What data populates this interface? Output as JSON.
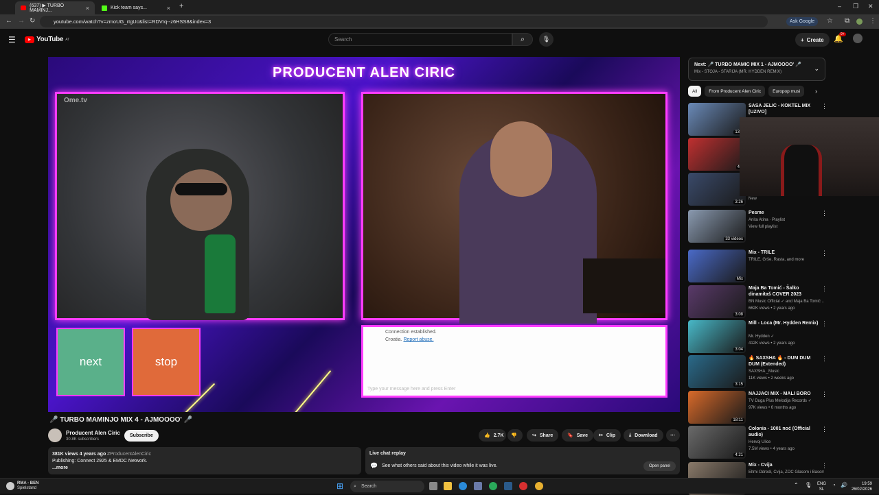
{
  "browser": {
    "tabs": [
      {
        "label": "(637) ▶ TURBO MAMINJ...",
        "active": true
      },
      {
        "label": "Kick team says...",
        "active": false
      }
    ],
    "new_tab": "+",
    "url": "youtube.com/watch?v=zmoUG_rIgUc&list=RDVrq--z6HSS8&index=3",
    "ask_google": "Ask Google"
  },
  "youtube": {
    "logo": "YouTube",
    "logo_region": "AT",
    "search_placeholder": "Search",
    "create_label": "Create",
    "notif_count": "9+"
  },
  "video": {
    "overlay_title": "PRODUCENT ALEN CIRIC",
    "ome_logo": "Ome.tv",
    "btn_next": "next",
    "btn_stop": "stop",
    "chat_line1": "Connection established.",
    "chat_line2": "Croatia.",
    "chat_report": "Report abuse.",
    "chat_placeholder": "Type your message here and press Enter",
    "title": "🎤 TURBO MAMINJO MIX 4 - AJMOOOO' 🎤"
  },
  "channel": {
    "name": "Producent Alen Ciric",
    "subs": "30.8K subscribers",
    "subscribe": "Subscribe"
  },
  "actions": {
    "likes": "2.7K",
    "share": "Share",
    "save": "Save",
    "clip": "Clip",
    "download": "Download"
  },
  "description": {
    "stats": "381K views  4 years ago",
    "hashtag": "#ProducentAlenCiric",
    "line2": "Publishing: Connect 2925 & EMDC Network.",
    "more": "...more"
  },
  "live_chat": {
    "title": "Live chat replay",
    "text": "See what others said about this video while it was live.",
    "open": "Open panel"
  },
  "sidebar": {
    "next_label": "Next: 🎤 TURBO MAMIC MIX 1 - AJMOOOO' 🎤",
    "next_sub": "Mix - STOJA - STARIJA (MR. HYDDEN REMIX)",
    "chips": [
      "All",
      "From Producent Alen Ciric",
      "Europop musi"
    ],
    "items": [
      {
        "title": "SASA JELIC - KOKTEL MIX [UZIVO]",
        "meta1": "",
        "meta2": "",
        "dur": "13:5",
        "color": "#6a8ab8"
      },
      {
        "title": "",
        "meta1": "",
        "meta2": "",
        "dur": "4:4",
        "color": "#c03030"
      },
      {
        "title": "",
        "meta1": "",
        "meta2": "New",
        "dur": "3:26",
        "color": "#3a4a6a"
      },
      {
        "title": "Pesme",
        "meta1": "Anita Atina · Playlist",
        "meta2": "View full playlist",
        "dur": "33 videos",
        "color": "#8a9ab0"
      },
      {
        "title": "Mix - TRILE",
        "meta1": "TRILE, Grše, Rasta, and more",
        "meta2": "",
        "dur": "Mix",
        "color": "#4a6ac8"
      },
      {
        "title": "Maja Ba Tomić - Šalko dinamitaš COVER 2023",
        "meta1": "BN Music Official ✓ and Maja Ba Tomić ...",
        "meta2": "662K views • 2 years ago",
        "dur": "3:08",
        "color": "#5a3a6a"
      },
      {
        "title": "Mill - Loca (Mr. Hydden Remix)",
        "meta1": "Mr. Hydden ✓",
        "meta2": "412K views • 2 years ago",
        "dur": "3:04",
        "color": "#48b8c8"
      },
      {
        "title": "🔥 SAXSHA 🔥 - DUM DUM DUM (Extended)",
        "meta1": "SAXSHA _Music",
        "meta2": "11K views • 2 weeks ago",
        "dur": "3:15",
        "color": "#2a6a8a"
      },
      {
        "title": "NAJJACI MIX - MALI BORO",
        "meta1": "TV Duga Plus Melodija Records ✓",
        "meta2": "97K views • 6 months ago",
        "dur": "18:11",
        "color": "#d86a2a"
      },
      {
        "title": "Colonia - 1001 noć (Official audio)",
        "meta1": "Hervoj Ulice",
        "meta2": "7.5M views • 4 years ago",
        "dur": "4:21",
        "color": "#6a6a6a"
      },
      {
        "title": "Mix - Cvija",
        "meta1": "Eltmi Odredi, Cvija, ZOC Glasom i Basom...",
        "meta2": "",
        "dur": "",
        "color": "#8a7a6a"
      }
    ]
  },
  "taskbar": {
    "weather1": "RMA - BEN",
    "weather2": "Spielstand",
    "search": "Search",
    "lang1": "ENG",
    "lang2": "SL",
    "time": "19:59",
    "date": "26/02/2026"
  }
}
